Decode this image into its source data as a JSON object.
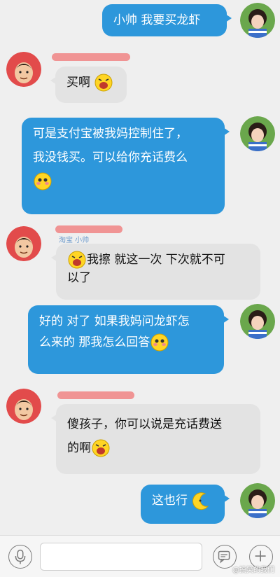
{
  "messages": [
    {
      "side": "right",
      "text": "小帅 我要买龙虾"
    },
    {
      "side": "left",
      "text": "买啊"
    },
    {
      "side": "right",
      "text_line1": "可是支付宝被我妈控制住了，",
      "text_line2": "我没钱买。可以给你充话费么"
    },
    {
      "side": "left",
      "text_line1": "我擦 就这一次 下次就不可",
      "text_line2": "以了",
      "sender_partial": "淘宝 小帅"
    },
    {
      "side": "right",
      "text_line1": "好的 对了 如果我妈问龙虾怎",
      "text_line2": "么来的 那我怎么回答"
    },
    {
      "side": "left",
      "text_line1": "傻孩子，你可以说是充话费送",
      "text_line2": "的啊"
    },
    {
      "side": "right",
      "text": "这也行"
    }
  ],
  "input_bar": {
    "voice_icon": "microphone-icon",
    "emoji_icon": "emoji-face-icon",
    "add_icon": "plus-icon",
    "input_value": ""
  },
  "watermark": "@搞笑的我们",
  "colors": {
    "right_bubble": "#2d97db",
    "left_bubble": "#e3e3e3",
    "background": "#efefef",
    "name_redaction": "#f08a8a"
  }
}
